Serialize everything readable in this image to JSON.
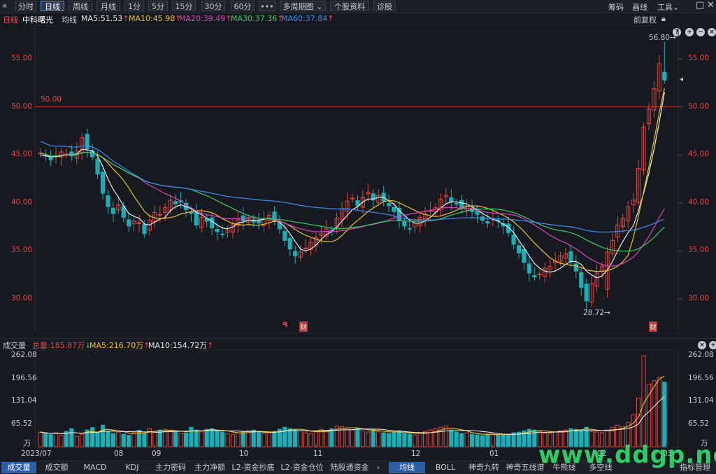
{
  "toolbar": {
    "back_icon": "double-chevron-left-icon",
    "periods": [
      "分时",
      "日线",
      "周线",
      "月线",
      "1分",
      "5分",
      "15分",
      "30分",
      "60分"
    ],
    "active_period": "日线",
    "more_label": "•••",
    "multi_period_label": "多周期图",
    "profile_label": "个股资料",
    "diagnose_label": "诊股",
    "chips_label": "筹码",
    "draw_label": "画线",
    "tools_label": "工具"
  },
  "chart_header": {
    "period_label": "日线",
    "stock_name": "中科曙光",
    "ma_label": "均线",
    "ma_items": [
      {
        "label": "MA5:51.53",
        "color": "#e8e8e8"
      },
      {
        "label": "MA10:45.98",
        "color": "#f0c020"
      },
      {
        "label": "MA20:39.49",
        "color": "#e040c0"
      },
      {
        "label": "MA30:37.36",
        "color": "#30d060"
      },
      {
        "label": "MA60:37.84",
        "color": "#3a8ef0"
      }
    ],
    "adjust_label": "前复权"
  },
  "price_axis": {
    "ticks": [
      "55.00",
      "50.00",
      "45.00",
      "40.00",
      "35.00",
      "30.00"
    ],
    "reference_line_label": "50.00",
    "high_label": "56.80→",
    "low_label": "28.72→",
    "events": [
      "财",
      "财"
    ]
  },
  "volume_panel": {
    "title": "成交量",
    "total_label": "总量:185.87万",
    "ma5_label": "MA5:216.70万",
    "ma10_label": "MA10:154.72万",
    "ticks": [
      "262.08",
      "196.56",
      "131.04",
      "65.52",
      "万"
    ]
  },
  "x_axis": {
    "labels": [
      "2023/07",
      "08",
      "09",
      "10",
      "11",
      "12",
      "01",
      "02",
      "03"
    ]
  },
  "bottom_tabs": {
    "left": [
      "成交量",
      "成交额",
      "MACD",
      "KDJ",
      "主力密码",
      "主力净额",
      "L2-资金抄底",
      "L2-资金仓位",
      "陆股通资金"
    ],
    "right": [
      "均线",
      "BOLL",
      "神奇九转",
      "神奇五线谱",
      "牛熊线",
      "多空线",
      "指标管理"
    ],
    "active_left": "成交量",
    "active_right": "均线"
  },
  "watermark": "www.ddgp.net",
  "colors": {
    "up": "#e0443c",
    "down": "#18b0b8",
    "background": "#16191f",
    "reference_line": "#c03030"
  },
  "chart_data": {
    "type": "candlestick",
    "title": "中科曙光 日线",
    "y_range": [
      27.5,
      57.5
    ],
    "reference_line": 50.0,
    "high": 56.8,
    "low": 28.72,
    "x_labels": [
      "2023/07",
      "08",
      "09",
      "10",
      "11",
      "12",
      "01",
      "02",
      "03"
    ],
    "closes": [
      45.2,
      44.9,
      44.5,
      44.9,
      45.3,
      45.1,
      44.9,
      45.4,
      46.8,
      45.6,
      44.8,
      43.0,
      41.0,
      39.6,
      38.9,
      39.8,
      38.5,
      37.6,
      38.1,
      37.9,
      36.8,
      38.2,
      39.0,
      38.8,
      39.5,
      40.3,
      39.9,
      40.1,
      39.3,
      38.9,
      37.7,
      38.5,
      38.1,
      37.4,
      37.0,
      36.7,
      37.2,
      37.8,
      38.3,
      38.1,
      38.4,
      38.0,
      37.9,
      38.3,
      38.7,
      38.1,
      37.3,
      36.1,
      35.2,
      34.5,
      34.9,
      35.3,
      35.9,
      36.4,
      36.8,
      37.3,
      37.1,
      38.4,
      39.4,
      40.2,
      40.5,
      39.7,
      40.6,
      41.1,
      40.3,
      40.8,
      40.2,
      39.7,
      39.1,
      38.2,
      37.6,
      37.3,
      37.9,
      38.5,
      38.8,
      39.2,
      39.5,
      40.4,
      40.8,
      40.1,
      39.9,
      39.4,
      39.7,
      39.1,
      38.8,
      38.2,
      37.9,
      38.4,
      38.1,
      37.6,
      36.9,
      35.7,
      34.8,
      33.8,
      32.7,
      32.3,
      32.6,
      33.2,
      33.4,
      34.0,
      34.5,
      34.7,
      33.9,
      32.9,
      31.2,
      29.8,
      31.6,
      32.7,
      33.4,
      34.9,
      36.1,
      37.7,
      38.4,
      39.6,
      40.3,
      43.6,
      47.9,
      49.8,
      51.9,
      54.5,
      52.8
    ],
    "ma5": [
      45.0,
      44.9,
      44.8,
      44.8,
      44.9,
      45.0,
      45.0,
      45.1,
      45.6,
      45.5,
      45.4,
      44.9,
      43.8,
      42.5,
      41.4,
      40.6,
      39.7,
      38.9,
      38.6,
      38.4,
      37.8,
      37.7,
      38.0,
      38.3,
      38.5,
      39.2,
      39.6,
      39.8,
      39.6,
      39.4,
      39.0,
      38.8,
      38.4,
      38.1,
      37.7,
      37.4,
      37.3,
      37.5,
      37.9,
      38.0,
      38.2,
      38.2,
      38.2,
      38.3,
      38.4,
      38.2,
      38.0,
      37.5,
      36.8,
      36.0,
      35.2,
      35.0,
      35.2,
      35.6,
      36.2,
      36.7,
      37.0,
      37.5,
      38.1,
      38.7,
      39.3,
      39.6,
      40.1,
      40.4,
      40.4,
      40.6,
      40.6,
      40.2,
      39.9,
      39.2,
      38.7,
      38.2,
      37.9,
      37.9,
      38.1,
      38.5,
      39.0,
      39.5,
      39.9,
      40.1,
      40.1,
      40.0,
      39.9,
      39.6,
      39.3,
      38.9,
      38.6,
      38.3,
      38.1,
      37.8,
      37.5,
      36.9,
      36.1,
      35.3,
      34.5,
      33.7,
      33.2,
      32.9,
      32.8,
      32.9,
      33.2,
      33.6,
      33.9,
      33.9,
      33.6,
      32.9,
      32.5,
      32.2,
      32.4,
      33.0,
      33.9,
      35.0,
      36.0,
      36.9,
      37.6,
      39.2,
      41.0,
      43.1,
      45.6,
      48.4,
      51.5
    ],
    "volume_ma5_label": "MA5:216.70万",
    "volume_ma10_label": "MA10:154.72万",
    "volume_max": 262.08,
    "volumes": [
      42,
      38,
      35,
      40,
      33,
      44,
      52,
      30,
      36,
      48,
      55,
      40,
      62,
      45,
      38,
      42,
      36,
      33,
      41,
      47,
      38,
      52,
      44,
      48,
      50,
      46,
      42,
      38,
      40,
      56,
      48,
      44,
      50,
      52,
      46,
      42,
      38,
      35,
      40,
      44,
      46,
      48,
      42,
      38,
      40,
      44,
      50,
      56,
      52,
      48,
      46,
      40,
      38,
      44,
      50,
      46,
      52,
      60,
      58,
      54,
      48,
      52,
      46,
      42,
      50,
      44,
      40,
      38,
      42,
      46,
      38,
      36,
      34,
      40,
      44,
      48,
      52,
      56,
      60,
      48,
      42,
      38,
      40,
      36,
      34,
      32,
      36,
      38,
      34,
      32,
      36,
      40,
      42,
      46,
      50,
      48,
      44,
      40,
      38,
      42,
      46,
      48,
      52,
      50,
      48,
      56,
      44,
      42,
      40,
      48,
      56,
      62,
      58,
      70,
      92,
      140,
      262,
      180,
      190,
      200,
      186
    ]
  }
}
